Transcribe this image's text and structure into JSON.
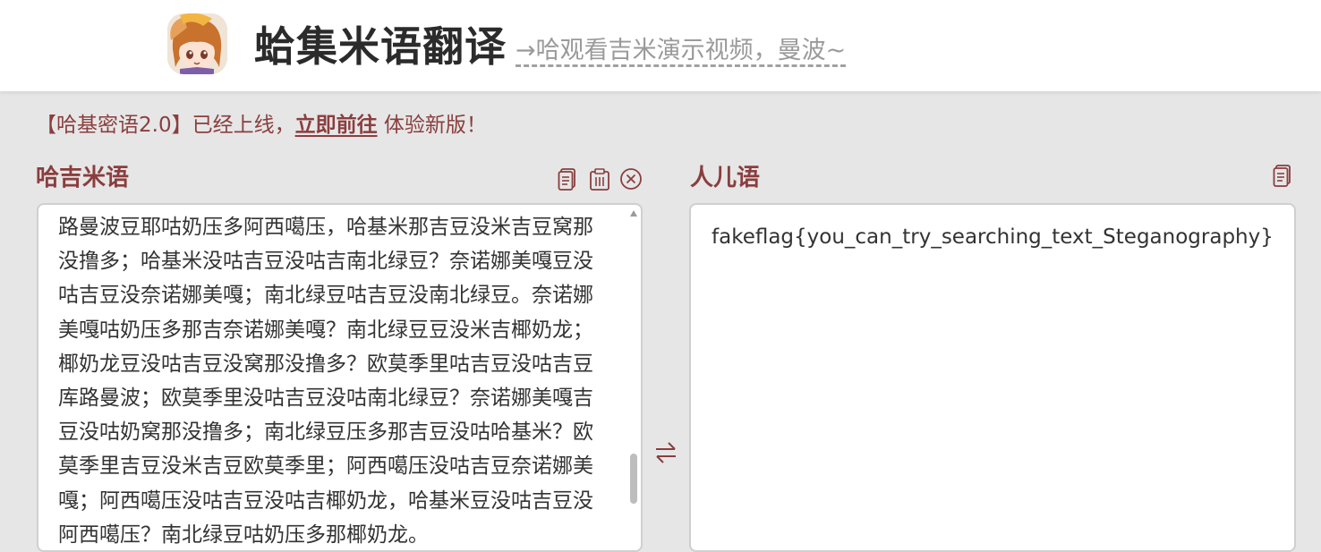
{
  "header": {
    "avatar_icon": "anime-girl-avatar-icon",
    "title": "蛤集米语翻译",
    "demo_link": "→哈观看吉米演示视频，曼波~"
  },
  "announcement": {
    "prefix": "【哈基密语2.0】已经上线，",
    "link": "立即前往",
    "suffix": " 体验新版！"
  },
  "left_panel": {
    "title": "哈吉米语",
    "icons": [
      "copy-icon",
      "paste-icon",
      "clear-icon"
    ],
    "text": "路曼波豆耶咕奶压多阿西噶压，哈基米那吉豆没米吉豆窝那没撸多；哈基米没咕吉豆没咕吉南北绿豆？奈诺娜美嘎豆没咕吉豆没奈诺娜美嘎；南北绿豆咕吉豆没南北绿豆。奈诺娜美嘎咕奶压多那吉奈诺娜美嘎？南北绿豆豆没米吉椰奶龙；椰奶龙豆没咕吉豆没窝那没撸多？欧莫季里咕吉豆没咕吉豆库路曼波；欧莫季里没咕吉豆没咕南北绿豆？奈诺娜美嘎吉豆没咕奶窝那没撸多；南北绿豆压多那吉豆没咕哈基米？欧莫季里吉豆没米吉豆欧莫季里；阿西噶压没咕吉豆奈诺娜美嘎；阿西噶压没咕吉豆没咕吉椰奶龙，哈基米豆没咕吉豆没阿西噶压？南北绿豆咕奶压多那椰奶龙。"
  },
  "right_panel": {
    "title": "人儿语",
    "icons": [
      "copy-icon"
    ],
    "text": "fakeflag{you_can_try_searching_text_Steganography}"
  },
  "swap_icon": "swap-arrows-icon",
  "colors": {
    "accent": "#8a3e3e",
    "background": "#e6e6e6",
    "header_bg": "#ffffff",
    "text": "#333333"
  }
}
